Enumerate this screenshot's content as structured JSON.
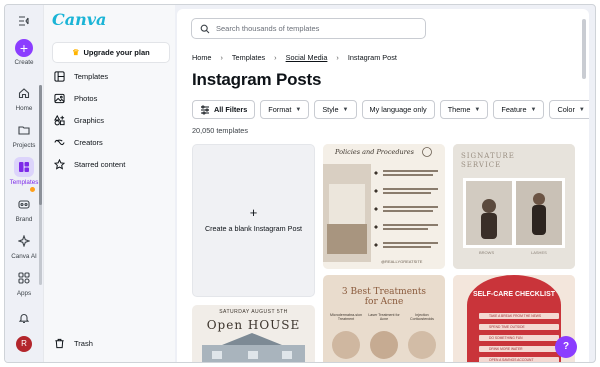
{
  "rail": {
    "create": "Create",
    "home": "Home",
    "projects": "Projects",
    "templates": "Templates",
    "brand": "Brand",
    "canva_ai": "Canva AI",
    "apps": "Apps",
    "avatar_initial": "R"
  },
  "sidebar": {
    "logo": "Canva",
    "upgrade": "Upgrade your plan",
    "items": [
      "Templates",
      "Photos",
      "Graphics",
      "Creators",
      "Starred content"
    ],
    "trash": "Trash"
  },
  "search": {
    "placeholder": "Search thousands of templates"
  },
  "breadcrumb": [
    "Home",
    "Templates",
    "Social Media",
    "Instagram Post"
  ],
  "page_title": "Instagram Posts",
  "filters": [
    "All Filters",
    "Format",
    "Style",
    "My language only",
    "Theme",
    "Feature",
    "Color"
  ],
  "template_count": "20,050 templates",
  "blank_card": "Create a blank Instagram Post",
  "templates": {
    "t1_title": "Policies and Procedures",
    "t1_email": "@REALLYGREATSITE",
    "t2_title": "SIGNATURE SERVICE",
    "t2_left": "BROWS",
    "t2_right": "LASHES",
    "t3_title": "3 Best Treatments for Acne",
    "t3_cols": [
      "Microdermabra-sion Treatment",
      "Laser Treatment for Acne",
      "Injection Corticosteroids"
    ],
    "t4_title": "SELF-CARE CHECKLIST",
    "t4_items": [
      "TAKE A BREAK FROM THE NEWS",
      "SPEND TIME OUTSIDE",
      "DO SOMETHING FUN",
      "DRINK MORE WATER",
      "OPEN A SAVINGS ACCOUNT"
    ],
    "t5_date": "SATURDAY AUGUST 5TH",
    "t5_title": "Open HOUSE"
  },
  "help_label": "?",
  "colors": {
    "accent": "#8b3dff",
    "brand": "#1bb4d6"
  }
}
